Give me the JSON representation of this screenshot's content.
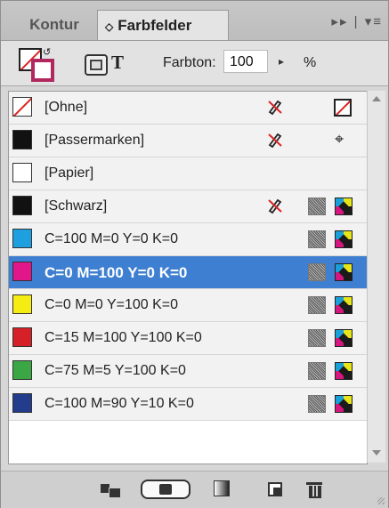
{
  "tabs": [
    {
      "label": "Kontur",
      "active": false
    },
    {
      "label": "Farbfelder",
      "active": true
    }
  ],
  "tab_controls": "▸▸ | ▾≡",
  "toolbar": {
    "text_icon": "T",
    "tint_label": "Farbton:",
    "tint_value": "100",
    "percent": "%"
  },
  "swatches": [
    {
      "name": "[Ohne]",
      "chip": "none",
      "icons": [
        "no-edit",
        "none"
      ]
    },
    {
      "name": "[Passermarken]",
      "chip": "#111111",
      "icons": [
        "no-edit",
        "registration"
      ]
    },
    {
      "name": "[Papier]",
      "chip": "#ffffff",
      "icons": []
    },
    {
      "name": "[Schwarz]",
      "chip": "#111111",
      "icons": [
        "no-edit",
        "process",
        "cmyk"
      ]
    },
    {
      "name": "C=100 M=0 Y=0 K=0",
      "chip": "#1ea0e0",
      "icons": [
        "process",
        "cmyk"
      ]
    },
    {
      "name": "C=0 M=100 Y=0 K=0",
      "chip": "#e0168a",
      "icons": [
        "process",
        "cmyk"
      ],
      "selected": true
    },
    {
      "name": "C=0 M=0 Y=100 K=0",
      "chip": "#f5ec14",
      "icons": [
        "process",
        "cmyk"
      ]
    },
    {
      "name": "C=15 M=100 Y=100 K=0",
      "chip": "#d62027",
      "icons": [
        "process",
        "cmyk"
      ]
    },
    {
      "name": "C=75 M=5 Y=100 K=0",
      "chip": "#3aa744",
      "icons": [
        "process",
        "cmyk"
      ]
    },
    {
      "name": "C=100 M=90 Y=10 K=0",
      "chip": "#243c8c",
      "icons": [
        "process",
        "cmyk"
      ]
    }
  ],
  "colors": {
    "selection": "#3f7fd2",
    "stroke_swatch": "#b0285e"
  }
}
